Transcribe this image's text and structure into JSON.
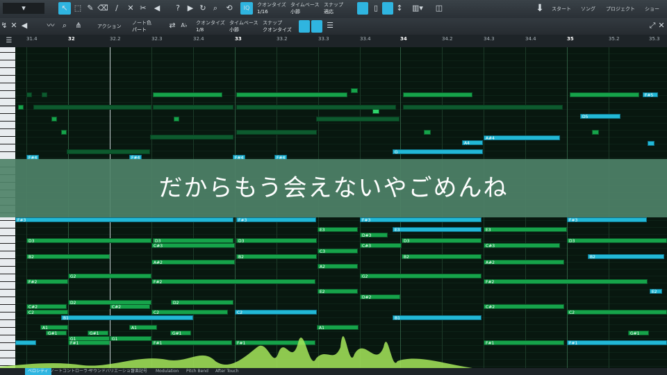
{
  "toolbar_top": {
    "quantize_label": "クオンタイズ",
    "quantize_value": "1/16",
    "timebase_label": "タイムベース",
    "timebase_value": "小節",
    "snap_label": "スナップ",
    "snap_value": "適応",
    "start_label": "スタート",
    "song_label": "ソング",
    "project_label": "プロジェクト",
    "show_label": "ショー"
  },
  "toolbar_editor": {
    "action_label": "アクション",
    "note_color_label": "ノート色",
    "note_color_value": "パート",
    "quantize_label": "クオンタイズ",
    "quantize_value": "1/8",
    "timebase_label": "タイムベース",
    "timebase_value": "小節",
    "snap_label": "スナップ",
    "snap_value": "クオンタイズ"
  },
  "ruler": [
    "31.4",
    "32",
    "32.2",
    "32.3",
    "32.4",
    "33",
    "33.2",
    "33.3",
    "33.4",
    "34",
    "34.2",
    "34.3",
    "34.4",
    "35",
    "35.2",
    "35.3"
  ],
  "subtitle": "だからもう会えないやごめんね",
  "bottom_tabs": [
    "ベロシティ",
    "ノートコントローラー",
    "サウンドバリエーション",
    "音楽記号",
    "Modulation",
    "Pitch Bend",
    "After Touch"
  ],
  "colors": {
    "accent": "#2fb5e0",
    "note_green": "#16a34a",
    "note_cyan": "#22b8d6",
    "banner": "#4e8268"
  }
}
